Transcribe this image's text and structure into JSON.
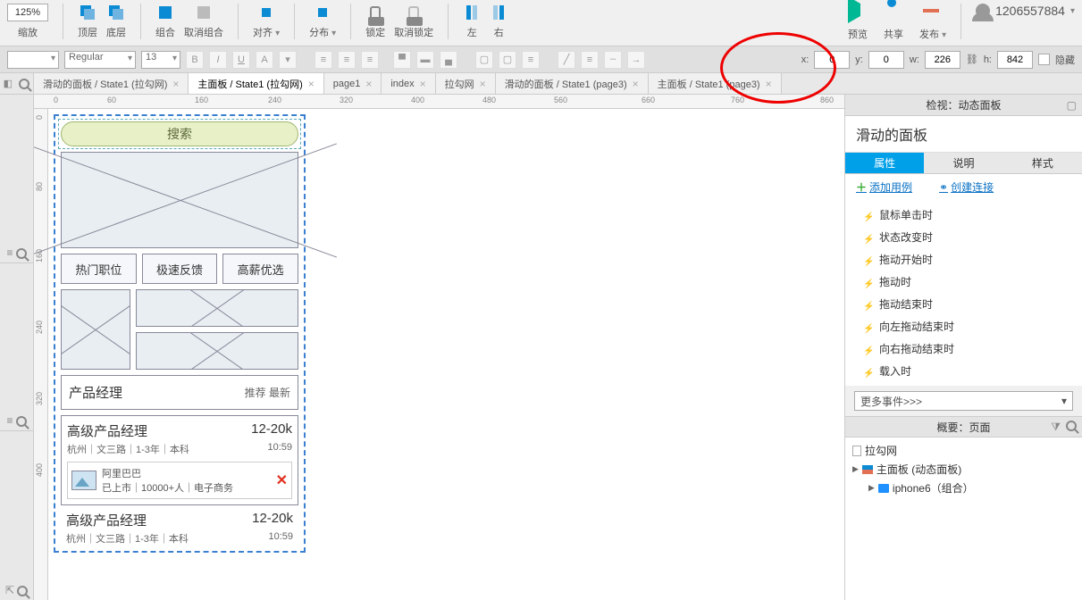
{
  "toolbar": {
    "zoom": "125%",
    "zoom_label": "缩放",
    "top_label": "顶层",
    "bottom_label": "底层",
    "group_label": "组合",
    "ungroup_label": "取消组合",
    "align_label": "对齐",
    "distribute_label": "分布",
    "lock_label": "锁定",
    "unlock_label": "取消锁定",
    "left_label": "左",
    "right_label": "右",
    "preview_label": "预览",
    "share_label": "共享",
    "publish_label": "发布",
    "user": "1206557884"
  },
  "format": {
    "font": "Regular",
    "size": "13",
    "x_label": "x:",
    "x": "0",
    "y_label": "y:",
    "y": "0",
    "w_label": "w:",
    "w": "226",
    "h_label": "h:",
    "h": "842",
    "hidden_label": "隐藏"
  },
  "tabs": [
    "滑动的面板 / State1 (拉勾网)",
    "主面板 / State1 (拉勾网)",
    "page1",
    "index",
    "拉勾网",
    "滑动的面板 / State1 (page3)",
    "主面板 / State1 (page3)"
  ],
  "active_tab": 1,
  "ruler_h": [
    "0",
    "60",
    "160",
    "240",
    "320",
    "400",
    "480",
    "560",
    "660",
    "760",
    "860"
  ],
  "ruler_v": [
    "0",
    "80",
    "160",
    "240",
    "320",
    "400"
  ],
  "wire": {
    "search": "搜索",
    "btns": [
      "热门职位",
      "极速反馈",
      "高薪优选"
    ],
    "section": "产品经理",
    "section_sub": "推荐 最新",
    "job_title": "高级产品经理",
    "job_salary": "12-20k",
    "job_loc": "杭州｜文三路｜1-3年｜本科",
    "job_time": "10:59",
    "company_name": "阿里巴巴",
    "company_info": "已上市｜10000+人｜电子商务",
    "job2_title": "高级产品经理",
    "job2_salary": "12-20k",
    "job2_loc": "杭州｜文三路｜1-3年｜本科",
    "job2_time": "10:59"
  },
  "right": {
    "inspect": "检视：动态面板",
    "panel_name": "滑动的面板",
    "tab_attr": "属性",
    "tab_desc": "说明",
    "tab_style": "样式",
    "add_case": "添加用例",
    "create_link": "创建连接",
    "events": [
      "鼠标单击时",
      "状态改变时",
      "拖动开始时",
      "拖动时",
      "拖动结束时",
      "向左拖动结束时",
      "向右拖动结束时",
      "载入时"
    ],
    "more_events": "更多事件>>>",
    "outline": "概要：页面",
    "tree": {
      "root": "拉勾网",
      "dp": "主面板 (动态面板)",
      "grp": "iphone6（组合）"
    }
  }
}
